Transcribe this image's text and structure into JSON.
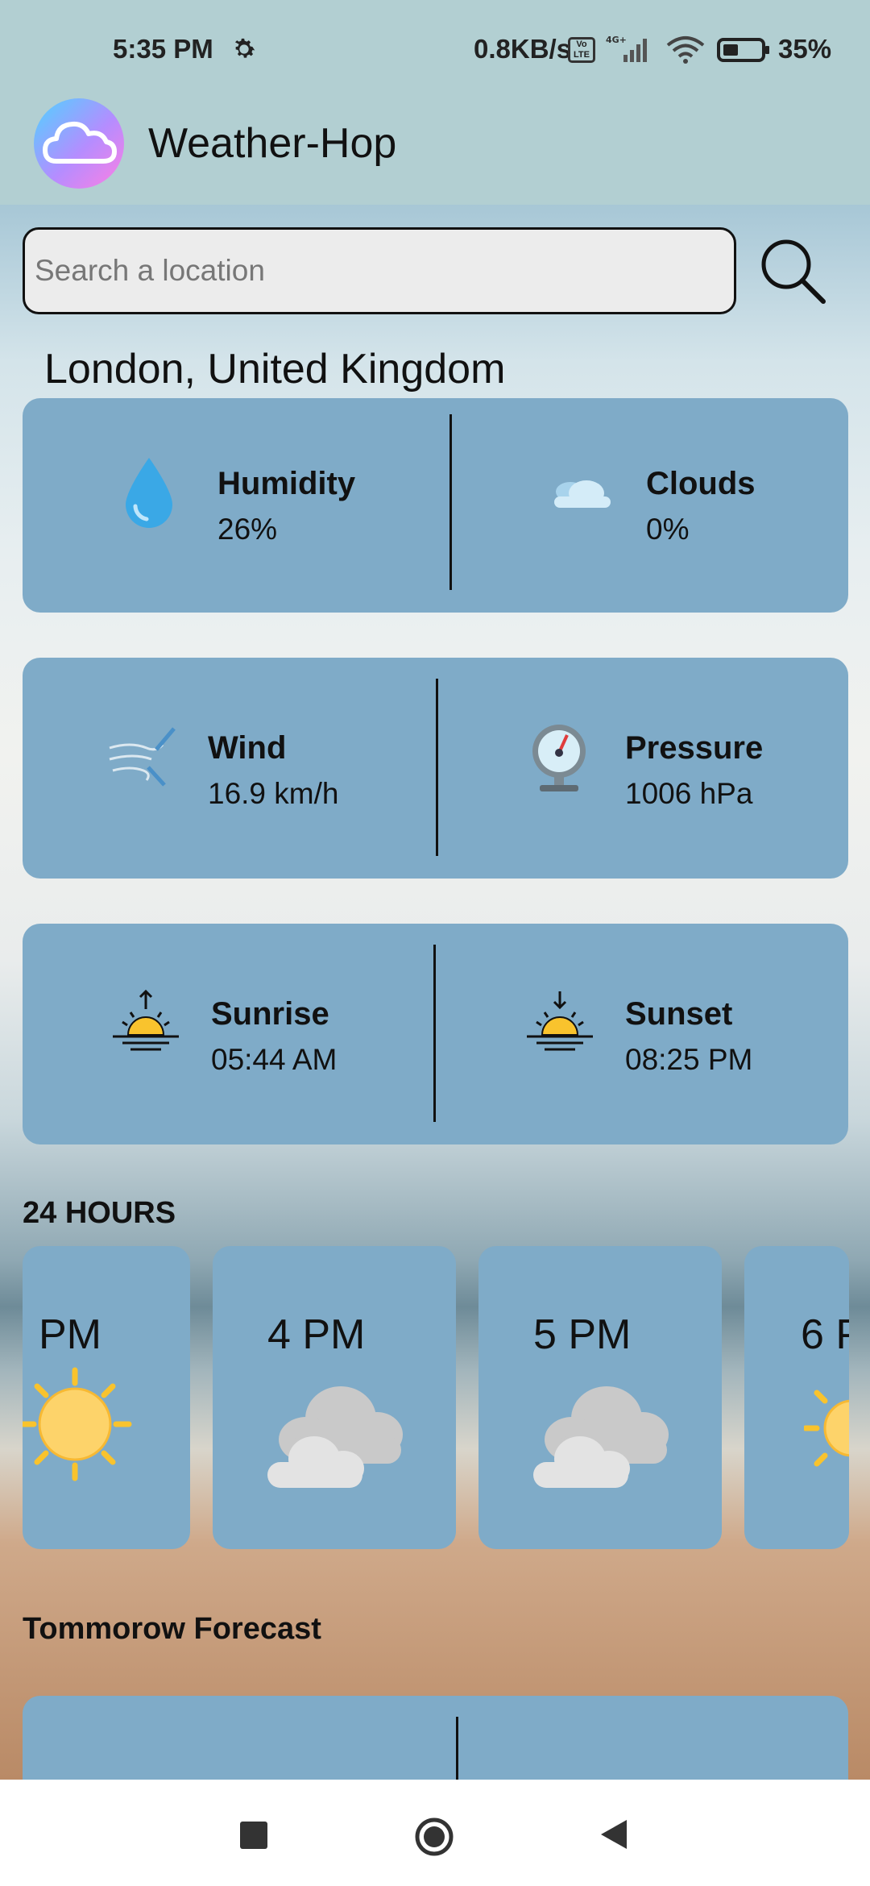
{
  "status": {
    "time": "5:35 PM",
    "net_speed": "0.8KB/s",
    "volte": "Vo LTE",
    "network": "4G+",
    "battery": "35%"
  },
  "app": {
    "title": "Weather-Hop"
  },
  "search": {
    "placeholder": "Search a location"
  },
  "location": "London, United Kingdom",
  "cards": {
    "humidity": {
      "label": "Humidity",
      "value": "26%"
    },
    "clouds": {
      "label": "Clouds",
      "value": "0%"
    },
    "wind": {
      "label": "Wind",
      "value": "16.9 km/h"
    },
    "pressure": {
      "label": "Pressure",
      "value": "1006 hPa"
    },
    "sunrise": {
      "label": "Sunrise",
      "value": "05:44 AM"
    },
    "sunset": {
      "label": "Sunset",
      "value": "08:25 PM"
    }
  },
  "hours_title": "24 HOURS",
  "hours": [
    {
      "label": "PM",
      "icon": "sun-icon"
    },
    {
      "label": "4 PM",
      "icon": "cloud-icon"
    },
    {
      "label": "5 PM",
      "icon": "cloud-icon"
    },
    {
      "label": "6 P",
      "icon": "sun-icon"
    }
  ],
  "tomorrow_title": "Tommorow Forecast",
  "colors": {
    "card": "#7fabc8",
    "header": "#b2cfd2",
    "accent": "#f9c32d"
  }
}
